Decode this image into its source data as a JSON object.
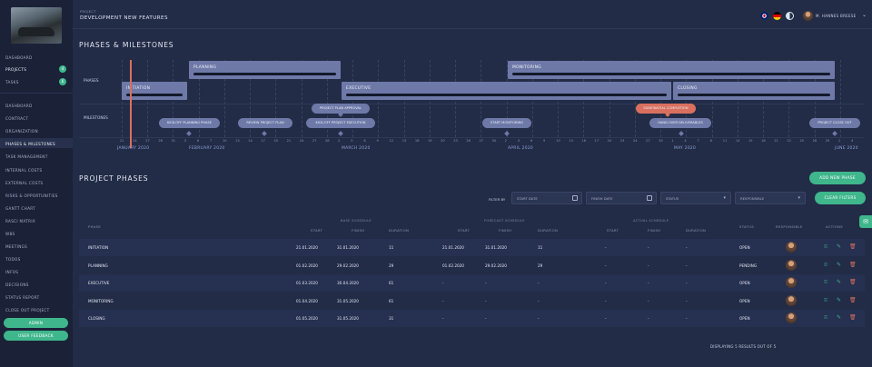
{
  "header": {
    "project_small": "PROJECT",
    "title": "DEVELOPMENT NEW FEATURES",
    "user_name": "M. HANNES BREESE"
  },
  "sidebar": {
    "items_top": [
      {
        "label": "DASHBOARD"
      },
      {
        "label": "PROJECTS",
        "badge": "4",
        "active": true
      },
      {
        "label": "TASKS",
        "badge": "6"
      }
    ],
    "items": [
      {
        "label": "DASHBOARD"
      },
      {
        "label": "CONTRACT"
      },
      {
        "label": "ORGANIZATION"
      },
      {
        "label": "PHASES & MILESTONES",
        "active": true
      },
      {
        "label": "TASK MANAGEMENT"
      },
      {
        "label": "INTERNAL COSTS"
      },
      {
        "label": "EXTERNAL COSTS"
      },
      {
        "label": "RISKS & OPPORTUNITIES"
      },
      {
        "label": "GANTT CHART"
      },
      {
        "label": "RASCI MATRIX"
      },
      {
        "label": "WBS"
      },
      {
        "label": "MEETINGS"
      },
      {
        "label": "TODOS"
      },
      {
        "label": "INFOS"
      },
      {
        "label": "DECISIONS"
      },
      {
        "label": "STATUS REPORT"
      },
      {
        "label": "CLOSE OUT PROJECT"
      }
    ],
    "admin_button": "ADMIN",
    "feedback_button": "USER FEEDBACK"
  },
  "timeline": {
    "title": "PHASES & MILESTONES",
    "row_phases": "PHASES",
    "row_milestones": "MILESTONES",
    "phases": [
      {
        "label": "PLANNING"
      },
      {
        "label": "MONITORING"
      },
      {
        "label": "INITIATION"
      },
      {
        "label": "EXECUTIVE"
      },
      {
        "label": "CLOSING"
      }
    ],
    "milestones": [
      {
        "label": "KICK-OFF PLANNING PHASE"
      },
      {
        "label": "REVIEW PROJECT PLAN"
      },
      {
        "label": "PROJECT PLAN APPROVAL"
      },
      {
        "label": "KICK-OFF PROJECT EXECUTION"
      },
      {
        "label": "START MONITORING"
      },
      {
        "label": "SUBSTANTIAL COMPLETION",
        "overdue": true
      },
      {
        "label": "HAND OVER DELIVERABLES"
      },
      {
        "label": "PROJECT CLOSE OUT"
      }
    ],
    "months": [
      "JANUARY 2020",
      "FEBRUARY 2020",
      "MARCH 2020",
      "APRIL 2020",
      "MAY 2020",
      "JUNE 2020"
    ],
    "days": [
      "21",
      "24",
      "27",
      "28",
      "31",
      "3",
      "6",
      "7",
      "10",
      "13",
      "14",
      "17",
      "20",
      "21",
      "24",
      "27",
      "28",
      "2",
      "5",
      "6",
      "9",
      "12",
      "13",
      "16",
      "19",
      "20",
      "23",
      "26",
      "27",
      "30",
      "2",
      "3",
      "6",
      "9",
      "10",
      "13",
      "16",
      "17",
      "20",
      "23",
      "24",
      "27",
      "30",
      "1",
      "4",
      "7",
      "8",
      "11",
      "14",
      "15",
      "18",
      "21",
      "22",
      "25",
      "28",
      "29",
      "1",
      "4"
    ]
  },
  "phases_table": {
    "title": "PROJECT PHASES",
    "add_button": "ADD NEW PHASE",
    "filter_by": "FILTER BY",
    "start_date_placeholder": "START DATE",
    "finish_date_placeholder": "FINISH DATE",
    "status_placeholder": "STATUS",
    "responsible_placeholder": "RESPONSIBLE",
    "clear_button": "CLEAR FILTERS",
    "groups": {
      "base": "BASE SCHEDULE",
      "forecast": "FORECAST SCHEDULE",
      "actual": "ACTUAL SCHEDULE"
    },
    "columns": {
      "phase": "PHASE",
      "start": "START",
      "finish": "FINISH",
      "duration": "DURATION",
      "status": "STATUS",
      "responsible": "RESPONSIBLE",
      "actions": "ACTIONS"
    },
    "rows": [
      {
        "phase": "INITIATION",
        "base_start": "21.01.2020",
        "base_finish": "31.01.2020",
        "base_duration": "11",
        "fc_start": "21.01.2020",
        "fc_finish": "31.01.2020",
        "fc_duration": "11",
        "act_start": "-",
        "act_finish": "-",
        "act_duration": "-",
        "status": "OPEN"
      },
      {
        "phase": "PLANNING",
        "base_start": "01.02.2020",
        "base_finish": "29.02.2020",
        "base_duration": "29",
        "fc_start": "01.02.2020",
        "fc_finish": "29.02.2020",
        "fc_duration": "29",
        "act_start": "-",
        "act_finish": "-",
        "act_duration": "-",
        "status": "PENDING"
      },
      {
        "phase": "EXECUTIVE",
        "base_start": "01.03.2020",
        "base_finish": "30.04.2020",
        "base_duration": "61",
        "fc_start": "-",
        "fc_finish": "-",
        "fc_duration": "-",
        "act_start": "-",
        "act_finish": "-",
        "act_duration": "-",
        "status": "OPEN"
      },
      {
        "phase": "MONITORING",
        "base_start": "01.04.2020",
        "base_finish": "31.05.2020",
        "base_duration": "61",
        "fc_start": "-",
        "fc_finish": "-",
        "fc_duration": "-",
        "act_start": "-",
        "act_finish": "-",
        "act_duration": "-",
        "status": "OPEN"
      },
      {
        "phase": "CLOSING",
        "base_start": "01.05.2020",
        "base_finish": "31.05.2020",
        "base_duration": "31",
        "fc_start": "-",
        "fc_finish": "-",
        "fc_duration": "-",
        "act_start": "-",
        "act_finish": "-",
        "act_duration": "-",
        "status": "OPEN"
      }
    ],
    "footer": "DISPLAYING 5 RESULTS OUT OF 5"
  },
  "icons": {
    "note": "edit-note-icon",
    "edit": "pencil-icon",
    "delete": "trash-icon",
    "chat": "chat-icon"
  },
  "colors": {
    "accent_green": "#3fb68c",
    "overdue_red": "#d9705f",
    "bar_blue": "#6e79a8",
    "background": "#222c47",
    "sidebar": "#1b2238"
  }
}
